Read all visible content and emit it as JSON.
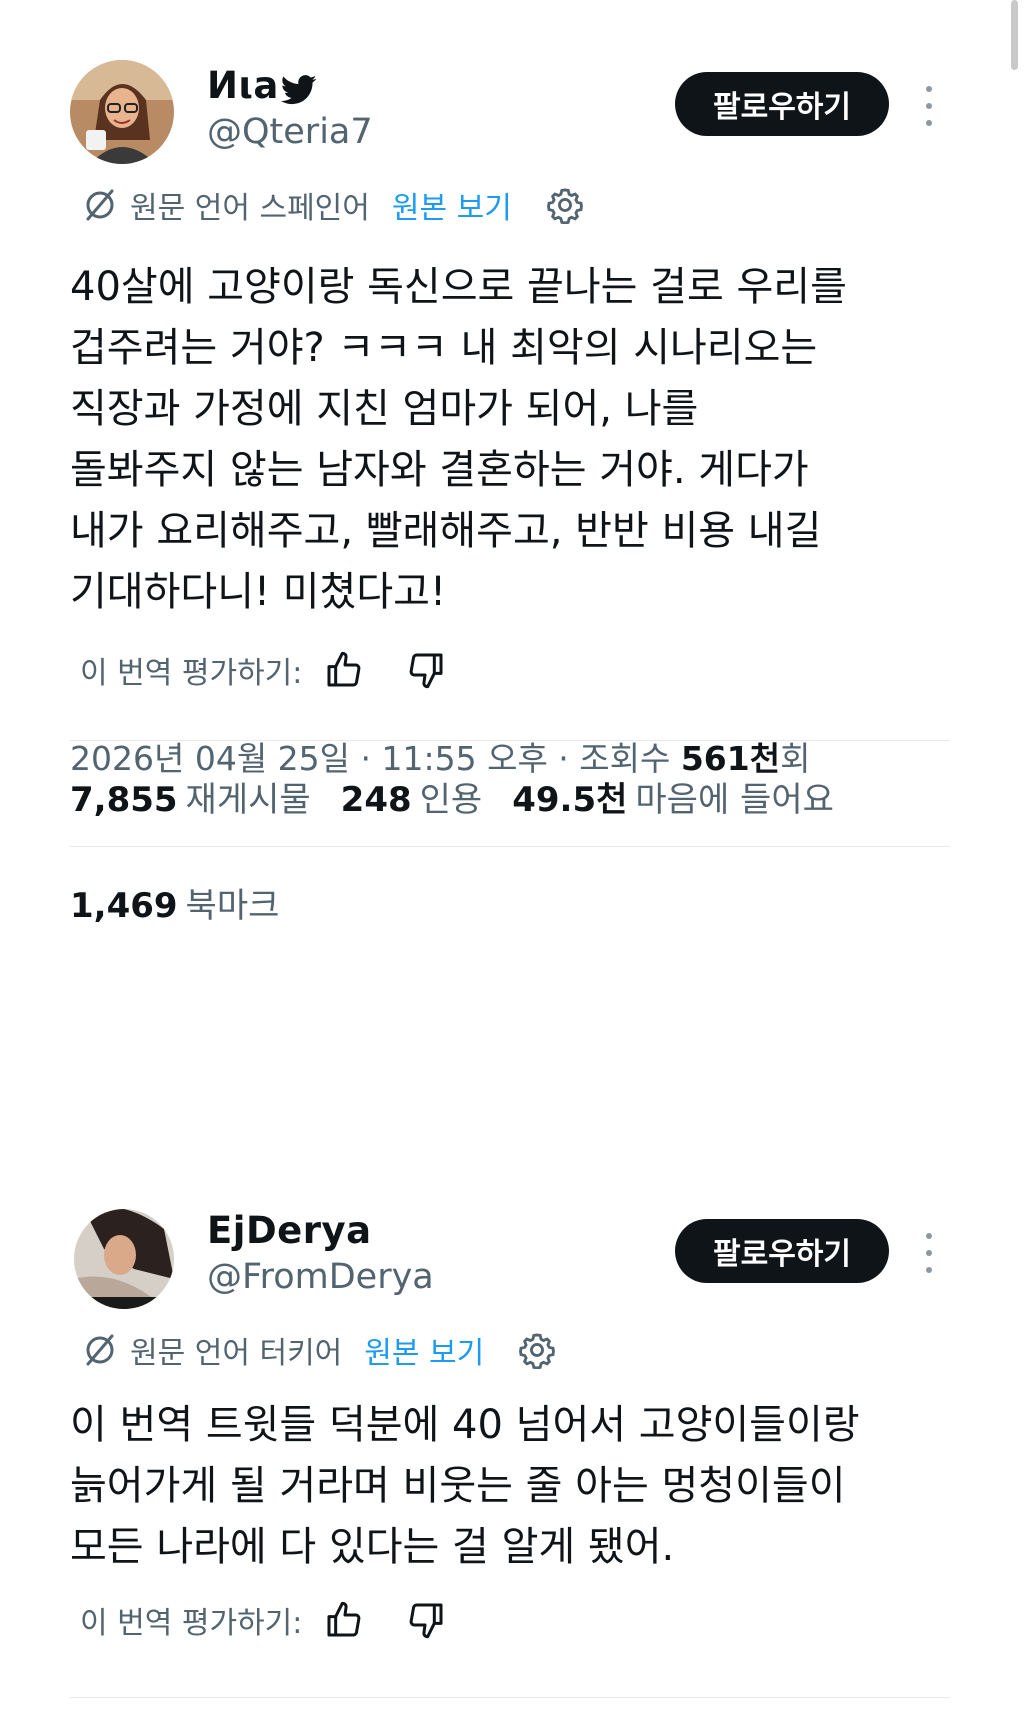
{
  "tweets": [
    {
      "display_name": "Иιa",
      "handle": "@Qteria7",
      "follow_label": "팔로우하기",
      "translation": {
        "source_label": "원문 언어 스페인어",
        "view_original": "원본 보기"
      },
      "text_lines": [
        "40살에 고양이랑 독신으로 끝나는 걸로 우리를",
        "겁주려는 거야? ㅋㅋㅋ 내 최악의 시나리오는",
        "직장과 가정에 지친 엄마가 되어, 나를",
        "돌봐주지 않는 남자와 결혼하는 거야. 게다가",
        "내가 요리해주고, 빨래해주고, 반반 비용 내길",
        "기대하다니! 미쳤다고!"
      ],
      "rate_label": "이 번역 평가하기:",
      "meta": {
        "datetime": "2026년 04월 25일 · 11:55 오후 · 조회수 ",
        "views": "561천",
        "views_suffix": "회"
      },
      "stats": {
        "reposts": "7,855",
        "reposts_label": "재게시물",
        "quotes": "248",
        "quotes_label": "인용",
        "likes": "49.5천",
        "likes_label": "마음에 들어요",
        "bookmarks": "1,469",
        "bookmarks_label": "북마크"
      }
    },
    {
      "display_name": "EjDerya",
      "handle": "@FromDerya",
      "follow_label": "팔로우하기",
      "translation": {
        "source_label": "원문 언어 터키어",
        "view_original": "원본 보기"
      },
      "text_lines": [
        "이 번역 트윗들 덕분에 40 넘어서 고양이들이랑",
        "늙어가게 될 거라며 비웃는 줄 아는 멍청이들이",
        "모든 나라에 다 있다는 걸 알게 됐어."
      ],
      "rate_label": "이 번역 평가하기:"
    }
  ],
  "icons": {
    "twitter_bird": "bird-icon",
    "more": "more-vertical-icon",
    "translate": "translate-icon",
    "settings": "gear-icon",
    "thumbs_up": "thumbs-up-icon",
    "thumbs_down": "thumbs-down-icon"
  },
  "colors": {
    "text": "#0f1419",
    "secondary": "#536471",
    "link": "#1d9bf0",
    "button_bg": "#0f1419",
    "divider": "#e7e9ea"
  }
}
